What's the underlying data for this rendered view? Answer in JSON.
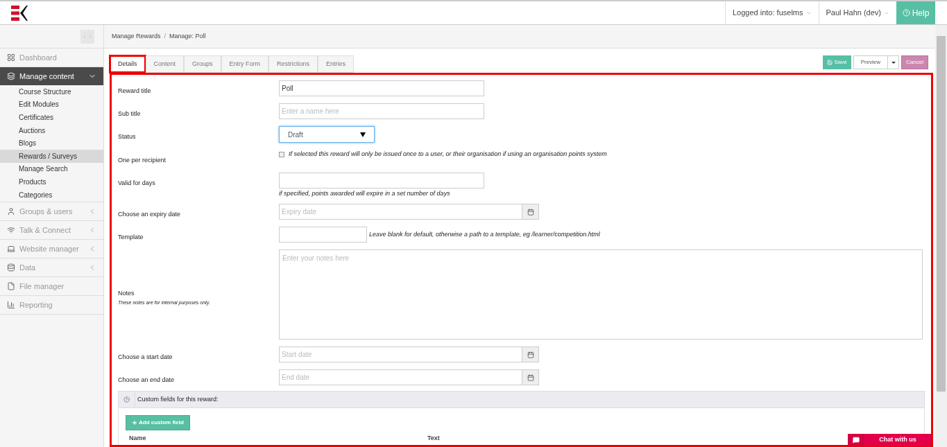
{
  "header": {
    "account": "Logged into: fuselms",
    "user": "Paul Hahn (dev)",
    "help": "Help"
  },
  "sidebar": {
    "items": [
      {
        "label": "Dashboard",
        "kind": "link",
        "expanded": false
      },
      {
        "label": "Manage content",
        "kind": "group",
        "expanded": true,
        "children": [
          {
            "label": "Course Structure",
            "selected": false
          },
          {
            "label": "Edit Modules",
            "selected": false
          },
          {
            "label": "Certificates",
            "selected": false
          },
          {
            "label": "Auctions",
            "selected": false
          },
          {
            "label": "Blogs",
            "selected": false
          },
          {
            "label": "Rewards / Surveys",
            "selected": true
          },
          {
            "label": "Manage Search",
            "selected": false
          },
          {
            "label": "Products",
            "selected": false
          },
          {
            "label": "Categories",
            "selected": false
          }
        ]
      },
      {
        "label": "Groups & users",
        "kind": "group",
        "expanded": false
      },
      {
        "label": "Talk & Connect",
        "kind": "group",
        "expanded": false
      },
      {
        "label": "Website manager",
        "kind": "group",
        "expanded": false
      },
      {
        "label": "Data",
        "kind": "group",
        "expanded": false
      },
      {
        "label": "File manager",
        "kind": "link",
        "expanded": false
      },
      {
        "label": "Reporting",
        "kind": "link",
        "expanded": false
      }
    ]
  },
  "breadcrumb": {
    "separator": "/",
    "items": [
      "Manage Rewards",
      "Manage: Poll"
    ]
  },
  "tabs": [
    {
      "label": "Details",
      "selected": true
    },
    {
      "label": "Content",
      "selected": false
    },
    {
      "label": "Groups",
      "selected": false
    },
    {
      "label": "Entry Form",
      "selected": false
    },
    {
      "label": "Restrictions",
      "selected": false
    },
    {
      "label": "Entries",
      "selected": false
    }
  ],
  "actions": {
    "save": "Save",
    "preview": "Preview",
    "cancel": "Cancel"
  },
  "form": [
    {
      "kind": "text",
      "label": "Reward title",
      "value": "Poll"
    },
    {
      "kind": "text",
      "label": "Sub title",
      "placeholder": "Enter a name here"
    },
    {
      "kind": "select",
      "label": "Status",
      "value": "Draft"
    },
    {
      "kind": "checkbox",
      "label": "One per recipient",
      "checked": false,
      "help": "If selected this reward will only be issued once to a user, or their organisation if using an organisation points system"
    },
    {
      "kind": "text",
      "label": "Valid for days",
      "help": "if specified, points awarded will expire in a set number of days"
    },
    {
      "kind": "date",
      "label": "Choose an expiry date",
      "placeholder": "Expiry date"
    },
    {
      "kind": "short",
      "label": "Template",
      "help": "Leave blank for default, otherwise a path to a template, eg /learner/competition.html"
    },
    {
      "kind": "textarea",
      "label": "Notes",
      "note": "These notes are for internal purposes only.",
      "placeholder": "Enter your notes here"
    },
    {
      "kind": "date",
      "label": "Choose a start date",
      "placeholder": "Start date"
    },
    {
      "kind": "date",
      "label": "Choose an end date",
      "placeholder": "End date"
    }
  ],
  "custom_fields": {
    "title": "Custom fields for this reward:",
    "add": "Add custom field",
    "columns": [
      "Name",
      "Text"
    ]
  },
  "chat": "Chat with us"
}
